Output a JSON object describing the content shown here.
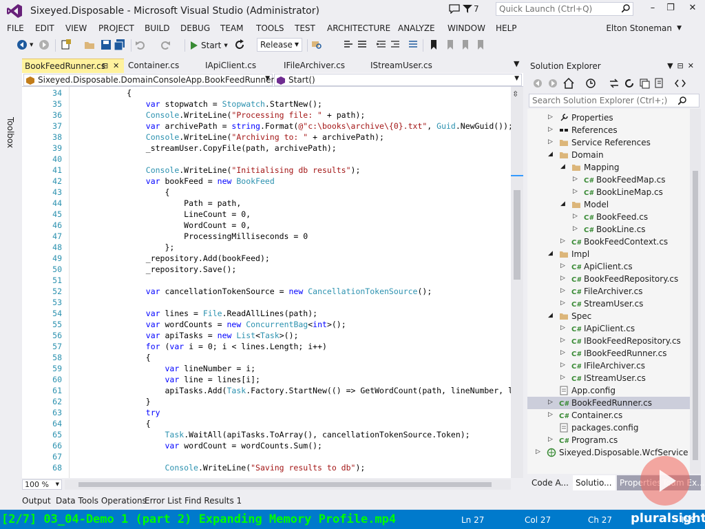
{
  "window": {
    "title": "Sixeyed.Disposable - Microsoft Visual Studio (Administrator)",
    "filter_count": "7",
    "quick_launch_placeholder": "Quick Launch (Ctrl+Q)",
    "minimize": "–",
    "restore": "❐",
    "close": "✕"
  },
  "menu": {
    "items": [
      "FILE",
      "EDIT",
      "VIEW",
      "PROJECT",
      "BUILD",
      "DEBUG",
      "TEAM",
      "TOOLS",
      "TEST",
      "ARCHITECTURE",
      "ANALYZE",
      "WINDOW",
      "HELP"
    ],
    "user": "Elton Stoneman"
  },
  "toolbar": {
    "start_label": "Start",
    "configuration": "Release"
  },
  "toolbox": {
    "label": "Toolbox"
  },
  "doc_tabs": {
    "active": "BookFeedRunner.cs",
    "others": [
      "Container.cs",
      "IApiClient.cs",
      "IFileArchiver.cs",
      "IStreamUser.cs"
    ]
  },
  "navbar": {
    "type": "Sixeyed.Disposable.DomainConsoleApp.BookFeedRunner",
    "member": "Start()"
  },
  "editor": {
    "zoom": "100 %",
    "lines": [
      {
        "n": "34",
        "code": "            {"
      },
      {
        "n": "35",
        "code": "                var stopwatch = Stopwatch.StartNew();"
      },
      {
        "n": "36",
        "code": "                Console.WriteLine(\"Processing file: \" + path);"
      },
      {
        "n": "37",
        "code": "                var archivePath = string.Format(@\"c:\\books\\archive\\{0}.txt\", Guid.NewGuid());"
      },
      {
        "n": "38",
        "code": "                Console.WriteLine(\"Archiving to: \" + archivePath);"
      },
      {
        "n": "39",
        "code": "                _streamUser.CopyFile(path, archivePath);"
      },
      {
        "n": "40",
        "code": ""
      },
      {
        "n": "41",
        "code": "                Console.WriteLine(\"Initialising db results\");"
      },
      {
        "n": "42",
        "code": "                var bookFeed = new BookFeed"
      },
      {
        "n": "43",
        "code": "                    {"
      },
      {
        "n": "44",
        "code": "                        Path = path,"
      },
      {
        "n": "45",
        "code": "                        LineCount = 0,"
      },
      {
        "n": "46",
        "code": "                        WordCount = 0,"
      },
      {
        "n": "47",
        "code": "                        ProcessingMilliseconds = 0"
      },
      {
        "n": "48",
        "code": "                    };"
      },
      {
        "n": "49",
        "code": "                _repository.Add(bookFeed);"
      },
      {
        "n": "50",
        "code": "                _repository.Save();"
      },
      {
        "n": "51",
        "code": ""
      },
      {
        "n": "52",
        "code": "                var cancellationTokenSource = new CancellationTokenSource();"
      },
      {
        "n": "53",
        "code": ""
      },
      {
        "n": "54",
        "code": "                var lines = File.ReadAllLines(path);"
      },
      {
        "n": "55",
        "code": "                var wordCounts = new ConcurrentBag<int>();"
      },
      {
        "n": "56",
        "code": "                var apiTasks = new List<Task>();"
      },
      {
        "n": "57",
        "code": "                for (var i = 0; i < lines.Length; i++)"
      },
      {
        "n": "58",
        "code": "                {"
      },
      {
        "n": "59",
        "code": "                    var lineNumber = i;"
      },
      {
        "n": "60",
        "code": "                    var line = lines[i];"
      },
      {
        "n": "61",
        "code": "                    apiTasks.Add(Task.Factory.StartNew(() => GetWordCount(path, lineNumber, lin"
      },
      {
        "n": "62",
        "code": "                }"
      },
      {
        "n": "63",
        "code": "                try"
      },
      {
        "n": "64",
        "code": "                {"
      },
      {
        "n": "65",
        "code": "                    Task.WaitAll(apiTasks.ToArray(), cancellationTokenSource.Token);"
      },
      {
        "n": "66",
        "code": "                    var wordCount = wordCounts.Sum();"
      },
      {
        "n": "67",
        "code": ""
      },
      {
        "n": "68",
        "code": "                    Console.WriteLine(\"Saving results to db\");"
      }
    ]
  },
  "bottom_tabs": [
    "Output",
    "Data Tools Operations",
    "Error List",
    "Find Results 1"
  ],
  "solution_explorer": {
    "title": "Solution Explorer",
    "search_placeholder": "Search Solution Explorer (Ctrl+;)",
    "tree": [
      {
        "label": "Properties",
        "indent": 1,
        "icon": "wrench-icon",
        "arrow": "right"
      },
      {
        "label": "References",
        "indent": 1,
        "icon": "references-icon",
        "arrow": "right"
      },
      {
        "label": "Service References",
        "indent": 1,
        "icon": "folder-icon",
        "arrow": "right"
      },
      {
        "label": "Domain",
        "indent": 1,
        "icon": "folder-icon",
        "arrow": "down"
      },
      {
        "label": "Mapping",
        "indent": 2,
        "icon": "folder-icon",
        "arrow": "down"
      },
      {
        "label": "BookFeedMap.cs",
        "indent": 3,
        "icon": "csharp-icon",
        "arrow": "right"
      },
      {
        "label": "BookLineMap.cs",
        "indent": 3,
        "icon": "csharp-icon",
        "arrow": "right"
      },
      {
        "label": "Model",
        "indent": 2,
        "icon": "folder-icon",
        "arrow": "down"
      },
      {
        "label": "BookFeed.cs",
        "indent": 3,
        "icon": "csharp-icon",
        "arrow": "right"
      },
      {
        "label": "BookLine.cs",
        "indent": 3,
        "icon": "csharp-icon",
        "arrow": "right"
      },
      {
        "label": "BookFeedContext.cs",
        "indent": 2,
        "icon": "csharp-icon",
        "arrow": "right"
      },
      {
        "label": "Impl",
        "indent": 1,
        "icon": "folder-icon",
        "arrow": "down"
      },
      {
        "label": "ApiClient.cs",
        "indent": 2,
        "icon": "csharp-icon",
        "arrow": "right"
      },
      {
        "label": "BookFeedRepository.cs",
        "indent": 2,
        "icon": "csharp-icon",
        "arrow": "right"
      },
      {
        "label": "FileArchiver.cs",
        "indent": 2,
        "icon": "csharp-icon",
        "arrow": "right"
      },
      {
        "label": "StreamUser.cs",
        "indent": 2,
        "icon": "csharp-icon",
        "arrow": "right"
      },
      {
        "label": "Spec",
        "indent": 1,
        "icon": "folder-icon",
        "arrow": "down"
      },
      {
        "label": "IApiClient.cs",
        "indent": 2,
        "icon": "csharp-icon",
        "arrow": "right"
      },
      {
        "label": "IBookFeedRepository.cs",
        "indent": 2,
        "icon": "csharp-icon",
        "arrow": "right"
      },
      {
        "label": "IBookFeedRunner.cs",
        "indent": 2,
        "icon": "csharp-icon",
        "arrow": "right"
      },
      {
        "label": "IFileArchiver.cs",
        "indent": 2,
        "icon": "csharp-icon",
        "arrow": "right"
      },
      {
        "label": "IStreamUser.cs",
        "indent": 2,
        "icon": "csharp-icon",
        "arrow": "right"
      },
      {
        "label": "App.config",
        "indent": 1,
        "icon": "config-icon",
        "arrow": "none"
      },
      {
        "label": "BookFeedRunner.cs",
        "indent": 1,
        "icon": "csharp-icon",
        "arrow": "right",
        "selected": true
      },
      {
        "label": "Container.cs",
        "indent": 1,
        "icon": "csharp-icon",
        "arrow": "right"
      },
      {
        "label": "packages.config",
        "indent": 1,
        "icon": "config-icon",
        "arrow": "none"
      },
      {
        "label": "Program.cs",
        "indent": 1,
        "icon": "csharp-icon",
        "arrow": "right"
      },
      {
        "label": "Sixeyed.Disposable.WcfService",
        "indent": 0,
        "icon": "project-icon",
        "arrow": "right"
      }
    ],
    "panel_tabs": [
      "Code A...",
      "Solutio...",
      "Properties",
      "Team Ex..."
    ]
  },
  "statusbar": {
    "video_caption": "[2/7] 03_04-Demo 1 (part 2) Expanding Memory Profile.mp4",
    "ln": "Ln 27",
    "col": "Col 27",
    "ch": "Ch 27",
    "ins": "INS"
  },
  "watermark": {
    "brand": "pluralsight"
  },
  "colors": {
    "accent": "#007ACC",
    "vs_purple": "#68217A",
    "active_tab": "#FFF29D",
    "keyword": "#0000FF",
    "string": "#A31515",
    "type": "#2B91AF",
    "caption": "#00FF00"
  }
}
